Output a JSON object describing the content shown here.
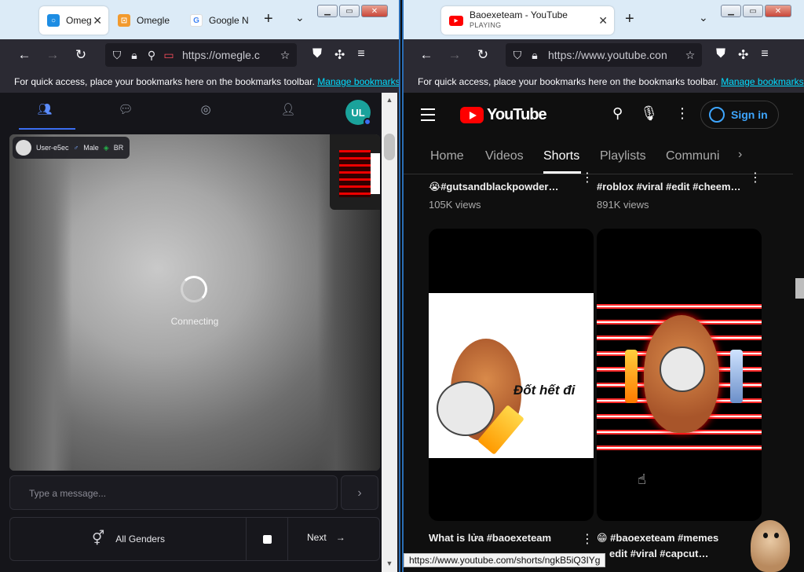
{
  "left": {
    "tabs": [
      {
        "label": "Omeg",
        "icon": "omegle-favicon",
        "active": true
      },
      {
        "label": "Omegle",
        "icon": "omegle-favicon"
      },
      {
        "label": "Google N",
        "icon": "google-favicon"
      }
    ],
    "url": "https://omegle.c",
    "bookmarks_text": "For quick access, place your bookmarks here on the bookmarks toolbar.",
    "bookmarks_link": "Manage bookmarks",
    "avatar_initials": "UL",
    "user_chip": {
      "name": "User-e5ec",
      "gender": "Male",
      "country": "BR"
    },
    "status_text": "Connecting",
    "message_placeholder": "Type a message...",
    "gender_filter": "All Genders",
    "next_label": "Next"
  },
  "right": {
    "tab": {
      "title": "Baoexeteam - YouTube",
      "subtitle": "PLAYING"
    },
    "url": "https://www.youtube.con",
    "bookmarks_text": "For quick access, place your bookmarks here on the bookmarks toolbar.",
    "bookmarks_link": "Manage bookmarks",
    "logo_text": "YouTube",
    "signin_label": "Sign in",
    "channel_tabs": [
      "Home",
      "Videos",
      "Shorts",
      "Playlists",
      "Communi"
    ],
    "active_tab": "Shorts",
    "shorts_top": [
      {
        "title": "😭#gutsandblackpowder…",
        "views": "105K views"
      },
      {
        "title": "#roblox #viral #edit #cheem…",
        "views": "891K views"
      }
    ],
    "shorts_bottom": [
      {
        "title": "What is lửa #baoexeteam",
        "overlay": "Đốt hết đi"
      },
      {
        "title": "😁 #baoexeteam #memes",
        "title2": "edit #viral #capcut…"
      }
    ],
    "status_url": "https://www.youtube.com/shorts/ngkB5iQ3IYg",
    "accent_red": "#ff0000",
    "link_blue": "#3ea6ff"
  }
}
